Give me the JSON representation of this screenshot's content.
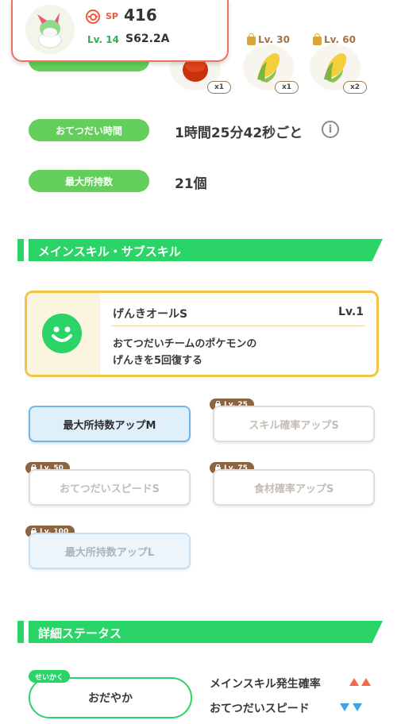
{
  "header": {
    "sp_label": "SP",
    "sp_value": "416",
    "level": "Lv. 14",
    "code": "S62.2A"
  },
  "ingredients": {
    "items": [
      {
        "count": "x1",
        "lock": ""
      },
      {
        "count": "x1",
        "lock": "Lv. 30"
      },
      {
        "count": "x2",
        "lock": "Lv. 60"
      }
    ]
  },
  "stats": {
    "help_time_label": "おてつだい時間",
    "help_time_value": "1時間25分42秒ごと",
    "max_carry_label": "最大所持数",
    "max_carry_value": "21個"
  },
  "skills_section": {
    "title": "メインスキル・サブスキル",
    "main": {
      "name": "げんきオールS",
      "level": "Lv.1",
      "desc_line1": "おてつだいチームのポケモンの",
      "desc_line2": "げんきを5回復する"
    },
    "subs": [
      {
        "label": "最大所持数アップM",
        "tag": ""
      },
      {
        "label": "スキル確率アップS",
        "tag": "Lv. 25"
      },
      {
        "label": "おてつだいスピードS",
        "tag": "Lv. 50"
      },
      {
        "label": "食材確率アップS",
        "tag": "Lv. 75"
      },
      {
        "label": "最大所持数アップL",
        "tag": "Lv. 100"
      }
    ]
  },
  "details_section": {
    "title": "詳細ステータス",
    "nature_tag": "せいかく",
    "nature_value": "おだやか",
    "up_effect": "メインスキル発生確率",
    "down_effect": "おてつだいスピード"
  },
  "colors": {
    "accent_green": "#2bd467",
    "header_border": "#f0715c",
    "skill_border": "#f1c448",
    "up_arrow": "#f0694a",
    "down_arrow": "#3fa3ec"
  }
}
